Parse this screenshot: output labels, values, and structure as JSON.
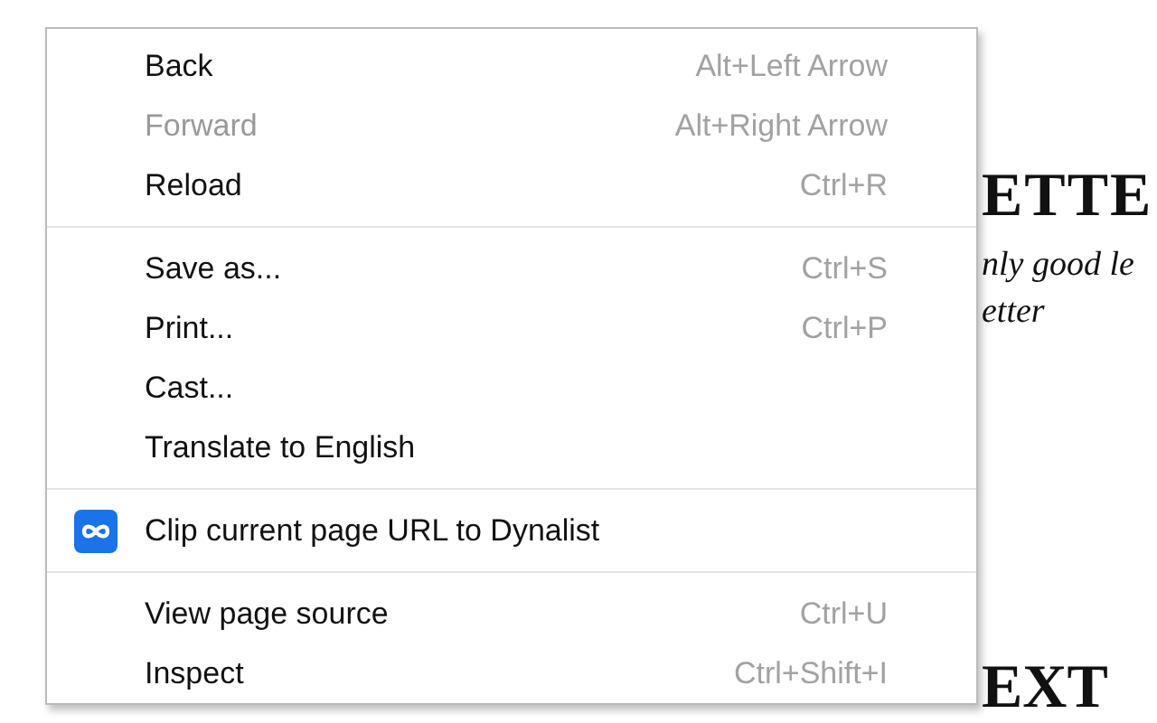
{
  "page": {
    "heading": "ETTE",
    "lines": [
      "nly good le",
      "etter"
    ],
    "heading_2": "EXT"
  },
  "menu": {
    "items": [
      {
        "kind": "item",
        "label": "Back",
        "shortcut": "Alt+Left Arrow",
        "disabled": false
      },
      {
        "kind": "item",
        "label": "Forward",
        "shortcut": "Alt+Right Arrow",
        "disabled": true
      },
      {
        "kind": "item",
        "label": "Reload",
        "shortcut": "Ctrl+R",
        "disabled": false
      },
      {
        "kind": "separator"
      },
      {
        "kind": "item",
        "label": "Save as...",
        "shortcut": "Ctrl+S",
        "disabled": false
      },
      {
        "kind": "item",
        "label": "Print...",
        "shortcut": "Ctrl+P",
        "disabled": false
      },
      {
        "kind": "item",
        "label": "Cast...",
        "disabled": false
      },
      {
        "kind": "item",
        "label": "Translate to English",
        "disabled": false
      },
      {
        "kind": "separator"
      },
      {
        "kind": "extension",
        "label": "Clip current page URL to Dynalist",
        "disabled": false
      },
      {
        "kind": "separator"
      },
      {
        "kind": "item",
        "label": "View page source",
        "shortcut": "Ctrl+U",
        "disabled": false
      },
      {
        "kind": "item",
        "label": "Inspect",
        "shortcut": "Ctrl+Shift+I",
        "disabled": false
      }
    ]
  }
}
